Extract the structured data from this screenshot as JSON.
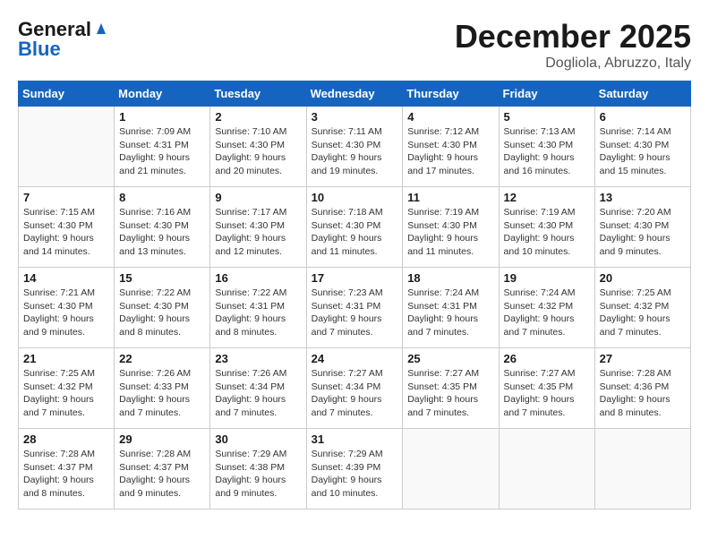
{
  "logo": {
    "line1": "General",
    "line2": "Blue"
  },
  "title": "December 2025",
  "location": "Dogliola, Abruzzo, Italy",
  "days_of_week": [
    "Sunday",
    "Monday",
    "Tuesday",
    "Wednesday",
    "Thursday",
    "Friday",
    "Saturday"
  ],
  "weeks": [
    [
      {
        "day": "",
        "info": ""
      },
      {
        "day": "1",
        "info": "Sunrise: 7:09 AM\nSunset: 4:31 PM\nDaylight: 9 hours\nand 21 minutes."
      },
      {
        "day": "2",
        "info": "Sunrise: 7:10 AM\nSunset: 4:30 PM\nDaylight: 9 hours\nand 20 minutes."
      },
      {
        "day": "3",
        "info": "Sunrise: 7:11 AM\nSunset: 4:30 PM\nDaylight: 9 hours\nand 19 minutes."
      },
      {
        "day": "4",
        "info": "Sunrise: 7:12 AM\nSunset: 4:30 PM\nDaylight: 9 hours\nand 17 minutes."
      },
      {
        "day": "5",
        "info": "Sunrise: 7:13 AM\nSunset: 4:30 PM\nDaylight: 9 hours\nand 16 minutes."
      },
      {
        "day": "6",
        "info": "Sunrise: 7:14 AM\nSunset: 4:30 PM\nDaylight: 9 hours\nand 15 minutes."
      }
    ],
    [
      {
        "day": "7",
        "info": "Sunrise: 7:15 AM\nSunset: 4:30 PM\nDaylight: 9 hours\nand 14 minutes."
      },
      {
        "day": "8",
        "info": "Sunrise: 7:16 AM\nSunset: 4:30 PM\nDaylight: 9 hours\nand 13 minutes."
      },
      {
        "day": "9",
        "info": "Sunrise: 7:17 AM\nSunset: 4:30 PM\nDaylight: 9 hours\nand 12 minutes."
      },
      {
        "day": "10",
        "info": "Sunrise: 7:18 AM\nSunset: 4:30 PM\nDaylight: 9 hours\nand 11 minutes."
      },
      {
        "day": "11",
        "info": "Sunrise: 7:19 AM\nSunset: 4:30 PM\nDaylight: 9 hours\nand 11 minutes."
      },
      {
        "day": "12",
        "info": "Sunrise: 7:19 AM\nSunset: 4:30 PM\nDaylight: 9 hours\nand 10 minutes."
      },
      {
        "day": "13",
        "info": "Sunrise: 7:20 AM\nSunset: 4:30 PM\nDaylight: 9 hours\nand 9 minutes."
      }
    ],
    [
      {
        "day": "14",
        "info": "Sunrise: 7:21 AM\nSunset: 4:30 PM\nDaylight: 9 hours\nand 9 minutes."
      },
      {
        "day": "15",
        "info": "Sunrise: 7:22 AM\nSunset: 4:30 PM\nDaylight: 9 hours\nand 8 minutes."
      },
      {
        "day": "16",
        "info": "Sunrise: 7:22 AM\nSunset: 4:31 PM\nDaylight: 9 hours\nand 8 minutes."
      },
      {
        "day": "17",
        "info": "Sunrise: 7:23 AM\nSunset: 4:31 PM\nDaylight: 9 hours\nand 7 minutes."
      },
      {
        "day": "18",
        "info": "Sunrise: 7:24 AM\nSunset: 4:31 PM\nDaylight: 9 hours\nand 7 minutes."
      },
      {
        "day": "19",
        "info": "Sunrise: 7:24 AM\nSunset: 4:32 PM\nDaylight: 9 hours\nand 7 minutes."
      },
      {
        "day": "20",
        "info": "Sunrise: 7:25 AM\nSunset: 4:32 PM\nDaylight: 9 hours\nand 7 minutes."
      }
    ],
    [
      {
        "day": "21",
        "info": "Sunrise: 7:25 AM\nSunset: 4:32 PM\nDaylight: 9 hours\nand 7 minutes."
      },
      {
        "day": "22",
        "info": "Sunrise: 7:26 AM\nSunset: 4:33 PM\nDaylight: 9 hours\nand 7 minutes."
      },
      {
        "day": "23",
        "info": "Sunrise: 7:26 AM\nSunset: 4:34 PM\nDaylight: 9 hours\nand 7 minutes."
      },
      {
        "day": "24",
        "info": "Sunrise: 7:27 AM\nSunset: 4:34 PM\nDaylight: 9 hours\nand 7 minutes."
      },
      {
        "day": "25",
        "info": "Sunrise: 7:27 AM\nSunset: 4:35 PM\nDaylight: 9 hours\nand 7 minutes."
      },
      {
        "day": "26",
        "info": "Sunrise: 7:27 AM\nSunset: 4:35 PM\nDaylight: 9 hours\nand 7 minutes."
      },
      {
        "day": "27",
        "info": "Sunrise: 7:28 AM\nSunset: 4:36 PM\nDaylight: 9 hours\nand 8 minutes."
      }
    ],
    [
      {
        "day": "28",
        "info": "Sunrise: 7:28 AM\nSunset: 4:37 PM\nDaylight: 9 hours\nand 8 minutes."
      },
      {
        "day": "29",
        "info": "Sunrise: 7:28 AM\nSunset: 4:37 PM\nDaylight: 9 hours\nand 9 minutes."
      },
      {
        "day": "30",
        "info": "Sunrise: 7:29 AM\nSunset: 4:38 PM\nDaylight: 9 hours\nand 9 minutes."
      },
      {
        "day": "31",
        "info": "Sunrise: 7:29 AM\nSunset: 4:39 PM\nDaylight: 9 hours\nand 10 minutes."
      },
      {
        "day": "",
        "info": ""
      },
      {
        "day": "",
        "info": ""
      },
      {
        "day": "",
        "info": ""
      }
    ]
  ]
}
